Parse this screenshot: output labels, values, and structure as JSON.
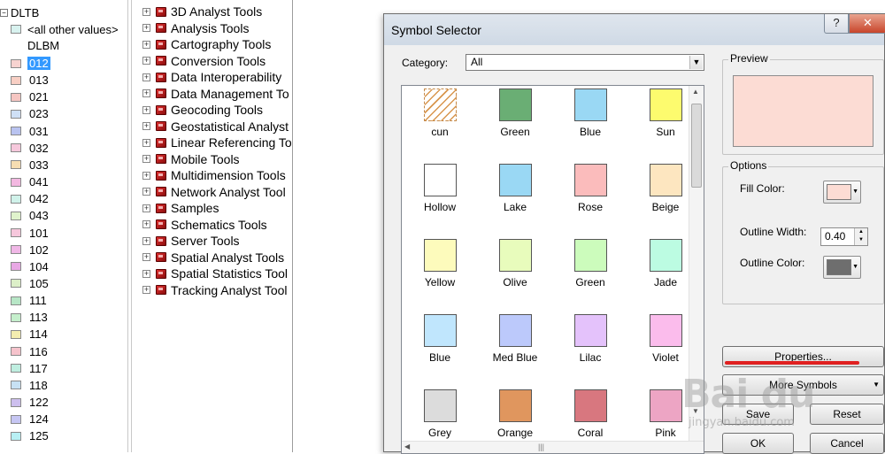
{
  "toc": {
    "layer": "DLTB",
    "other_values": "<all other values>",
    "field": "DLBM",
    "items": [
      {
        "label": "012",
        "color": "#f7d3d0",
        "selected": true
      },
      {
        "label": "013",
        "color": "#f8cfc4"
      },
      {
        "label": "021",
        "color": "#f6c6c2"
      },
      {
        "label": "023",
        "color": "#cfe0f6"
      },
      {
        "label": "031",
        "color": "#b9c3f0"
      },
      {
        "label": "032",
        "color": "#f6c8dc"
      },
      {
        "label": "033",
        "color": "#f6ddb2"
      },
      {
        "label": "041",
        "color": "#f3b8e1"
      },
      {
        "label": "042",
        "color": "#d0f2ea"
      },
      {
        "label": "043",
        "color": "#e0f3cc"
      },
      {
        "label": "101",
        "color": "#f6c7dc"
      },
      {
        "label": "102",
        "color": "#f0b7e6"
      },
      {
        "label": "104",
        "color": "#e8a8e4"
      },
      {
        "label": "105",
        "color": "#dcefc8"
      },
      {
        "label": "111",
        "color": "#b7e6c6"
      },
      {
        "label": "113",
        "color": "#c5efcc"
      },
      {
        "label": "114",
        "color": "#f4edb0"
      },
      {
        "label": "116",
        "color": "#f6c3cc"
      },
      {
        "label": "117",
        "color": "#bfeee0"
      },
      {
        "label": "118",
        "color": "#c7e1f4"
      },
      {
        "label": "122",
        "color": "#cdbfee"
      },
      {
        "label": "124",
        "color": "#c6c6f3"
      },
      {
        "label": "125",
        "color": "#b8f0f4"
      }
    ]
  },
  "toolbox": {
    "items": [
      "3D Analyst Tools",
      "Analysis Tools",
      "Cartography Tools",
      "Conversion Tools",
      "Data Interoperability",
      "Data Management To",
      "Geocoding Tools",
      "Geostatistical Analyst",
      "Linear Referencing To",
      "Mobile Tools",
      "Multidimension Tools",
      "Network Analyst Tool",
      "Samples",
      "Schematics Tools",
      "Server Tools",
      "Spatial Analyst Tools",
      "Spatial Statistics Tool",
      "Tracking Analyst Tool"
    ]
  },
  "dialog": {
    "title": "Symbol Selector",
    "help": "?",
    "close": "✕",
    "category_label": "Category:",
    "category_value": "All",
    "symbols": [
      {
        "name": "cun",
        "color": "#ffffff",
        "hatched": true
      },
      {
        "name": "Green",
        "color": "#6aae74"
      },
      {
        "name": "Blue",
        "color": "#9ad8f4"
      },
      {
        "name": "Sun",
        "color": "#fdfb6e"
      },
      {
        "name": "Hollow",
        "color": "#ffffff"
      },
      {
        "name": "Lake",
        "color": "#9ad8f4"
      },
      {
        "name": "Rose",
        "color": "#fbbcbc"
      },
      {
        "name": "Beige",
        "color": "#fde6c0"
      },
      {
        "name": "Yellow",
        "color": "#fdfbbc"
      },
      {
        "name": "Olive",
        "color": "#e8fcbc"
      },
      {
        "name": "Green",
        "color": "#ccfcbc"
      },
      {
        "name": "Jade",
        "color": "#bcfce2"
      },
      {
        "name": "Blue",
        "color": "#c0e6fd"
      },
      {
        "name": "Med Blue",
        "color": "#bcc9fb"
      },
      {
        "name": "Lilac",
        "color": "#e4c2fb"
      },
      {
        "name": "Violet",
        "color": "#fbbcec"
      },
      {
        "name": "Grey",
        "color": "#dcdcdc"
      },
      {
        "name": "Orange",
        "color": "#e0965e"
      },
      {
        "name": "Coral",
        "color": "#d8777f"
      },
      {
        "name": "Pink",
        "color": "#eda5c4"
      }
    ],
    "preview_label": "Preview",
    "preview_color": "#fcdcd4",
    "options_label": "Options",
    "fill_color_label": "Fill Color:",
    "fill_color": "#fcdcd4",
    "outline_width_label": "Outline Width:",
    "outline_width": "0.40",
    "outline_color_label": "Outline Color:",
    "outline_color": "#6e6e6e",
    "properties_btn": "Properties...",
    "more_symbols_btn": "More Symbols",
    "save_btn": "Save",
    "reset_btn": "Reset",
    "ok_btn": "OK",
    "cancel_btn": "Cancel"
  },
  "watermark": {
    "text": "Bai du",
    "sub": "jingyan.baidu.com"
  }
}
